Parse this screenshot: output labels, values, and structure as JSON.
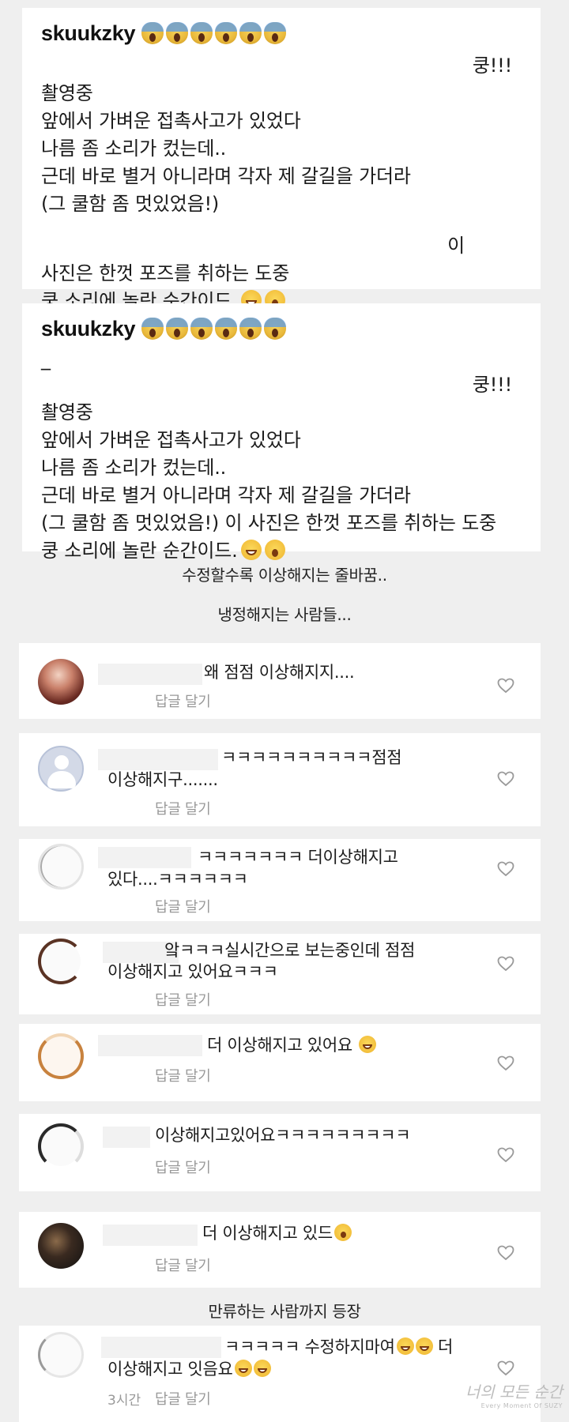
{
  "posts": [
    {
      "username": "skuukzky",
      "lines": [
        "쿵!!!",
        "촬영중",
        "앞에서 가벼운 접촉사고가 있었다",
        "나름 좀 소리가 컸는데..",
        "근데 바로 별거 아니라며 각자 제 갈길을 가더라",
        "(그 쿨함 좀 멋있었음!)",
        "이",
        "사진은 한껏 포즈를 취하는 도중",
        "쿵 소리에 놀란 순간이드."
      ]
    },
    {
      "username": "skuukzky",
      "lines": [
        "_",
        "쿵!!!",
        "촬영중",
        "앞에서 가벼운 접촉사고가 있었다",
        "나름 좀 소리가 컸는데..",
        "근데 바로 별거 아니라며 각자 제 갈길을 가더라",
        "(그 쿨함 좀 멋있었음!) 이 사진은 한껏 포즈를 취하는 도중",
        "쿵 소리에 놀란 순간이드."
      ]
    }
  ],
  "captions": {
    "c1": "수정할수록 이상해지는 줄바꿈..",
    "c2": "냉정해지는 사람들...",
    "c3": "만류하는 사람까지 등장"
  },
  "comments": [
    {
      "line1": "왜 점점 이상해지지....",
      "line2": "",
      "reply": "답글 달기",
      "avatar": "photo-avatar"
    },
    {
      "line1": "ㅋㅋㅋㅋㅋㅋㅋㅋㅋㅋ점점",
      "line2": "이상해지구.......",
      "reply": "답글 달기",
      "avatar": "default-avatar"
    },
    {
      "line1": "ㅋㅋㅋㅋㅋㅋㅋ 더이상해지고",
      "line2": "있다....ㅋㅋㅋㅋㅋㅋ",
      "reply": "답글 달기",
      "avatar": "ring-avatar"
    },
    {
      "line1": "앜ㅋㅋㅋ실시간으로 보는중인데 점점",
      "line2": "이상해지고 있어요ㅋㅋㅋ",
      "reply": "답글 달기",
      "avatar": "ring-avatar"
    },
    {
      "line1": "더 이상해지고 있어요",
      "line2": "",
      "reply": "답글 달기",
      "avatar": "ring-avatar"
    },
    {
      "line1": "이상해지고있어요ㅋㅋㅋㅋㅋㅋㅋㅋㅋ",
      "line2": "",
      "reply": "답글 달기",
      "avatar": "ring-avatar"
    },
    {
      "line1": "더 이상해지고 있드",
      "line2": "",
      "reply": "답글 달기",
      "avatar": "photo-avatar"
    },
    {
      "line1": "ㅋㅋㅋㅋㅋ 수정하지마여",
      "line1b": "더",
      "line2": "이상해지고 잇음요",
      "reply": "답글 달기",
      "time": "3시간",
      "avatar": "ring-avatar"
    }
  ],
  "watermark": {
    "main": "너의 모든 순간",
    "sub": "Every Moment Of SUZY"
  }
}
